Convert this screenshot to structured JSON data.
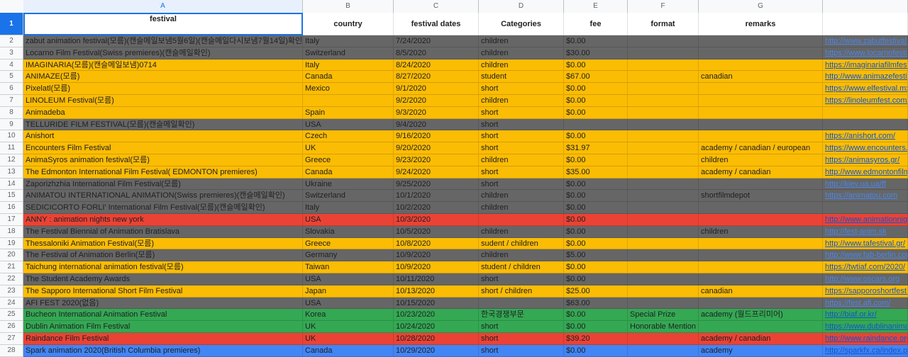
{
  "columns": [
    {
      "letter": "A",
      "header": "festival"
    },
    {
      "letter": "B",
      "header": "country"
    },
    {
      "letter": "C",
      "header": "festival dates"
    },
    {
      "letter": "D",
      "header": "Categories"
    },
    {
      "letter": "E",
      "header": "fee"
    },
    {
      "letter": "F",
      "header": "format"
    },
    {
      "letter": "G",
      "header": "remarks"
    },
    {
      "letter": "",
      "header": ""
    }
  ],
  "header_row_number": "1",
  "colors": {
    "gray": "#666666",
    "orange": "#fbbc04",
    "red": "#ea4335",
    "green": "#34a853",
    "blue": "#4285f4",
    "selection": "#1a73e8"
  },
  "rows": [
    {
      "n": "2",
      "color": "gray",
      "cells": [
        "zabut animation festival(모름)(캔슬메일보냄5월6일)(캔슬메일다시보냄7월14일)확인",
        "Italy",
        "7/24/2020",
        "children",
        "$0.00",
        "",
        "",
        "http://www.zabutfestival.it"
      ]
    },
    {
      "n": "3",
      "color": "gray",
      "cells": [
        "Locarno Film Festival(Swiss premieres)(캔슬메일확인)",
        "Switzerland",
        "8/5/2020",
        "children",
        "$30.00",
        "",
        "",
        "https://www.locarnofestival.ch"
      ]
    },
    {
      "n": "4",
      "color": "orange",
      "cells": [
        "IMAGINARIA(모름)(캔슬메일보냄)0714",
        "Italy",
        "8/24/2020",
        "children",
        "$0.00",
        "",
        "",
        "https://imaginariafilmfestival.org"
      ]
    },
    {
      "n": "5",
      "color": "orange",
      "cells": [
        "ANIMAZE(모름)",
        "Canada",
        "8/27/2020",
        "student",
        "$67.00",
        "",
        " canadian",
        "http://www.animazefestival.com"
      ]
    },
    {
      "n": "6",
      "color": "orange",
      "cells": [
        "Pixelatl(모름)",
        "Mexico",
        "9/1/2020",
        "short",
        "$0.00",
        "",
        "",
        "https://www.elfestival.mx/"
      ]
    },
    {
      "n": "7",
      "color": "orange",
      "cells": [
        "LINOLEUM Festival(모름)",
        "",
        "9/2/2020",
        "children",
        "$0.00",
        "",
        "",
        "https://linoleumfest.com/en"
      ]
    },
    {
      "n": "8",
      "color": "orange",
      "cells": [
        "Animadeba",
        "Spain",
        "9/3/2020",
        "short",
        "$0.00",
        "",
        "",
        ""
      ]
    },
    {
      "n": "9",
      "color": "gray",
      "cells": [
        "TELLURIDE FILM FESTIVAL(모름)(캔슬메일확인)",
        "USA",
        "9/4/2020",
        "short",
        "",
        "",
        "",
        ""
      ]
    },
    {
      "n": "10",
      "color": "orange",
      "cells": [
        "Anishort",
        "Czech",
        "9/16/2020",
        "short",
        "$0.00",
        "",
        "",
        "https://anishort.com/"
      ]
    },
    {
      "n": "11",
      "color": "orange",
      "cells": [
        "Encounters Film Festival",
        "UK",
        "9/20/2020",
        "short",
        "$31.97",
        "",
        "academy / canadian / european",
        "https://www.encounters.film"
      ]
    },
    {
      "n": "12",
      "color": "orange",
      "cells": [
        "AnimaSyros animation festival(모름)",
        "Greece",
        "9/23/2020",
        "children",
        "$0.00",
        "",
        "children",
        "https://animasyros.gr/"
      ]
    },
    {
      "n": "13",
      "color": "orange",
      "cells": [
        "The Edmonton International Film Festival( EDMONTON premieres)",
        "Canada",
        "9/24/2020",
        "short",
        "$35.00",
        "",
        "academy / canadian",
        "http://www.edmontonfilmfest.com"
      ]
    },
    {
      "n": "14",
      "color": "gray",
      "cells": [
        "Zaporizhzhia International Film Festival(모름)",
        "Ukraine",
        "9/25/2020",
        "short",
        "$0.00",
        "",
        "",
        "http://kiev.ua.ua/ff"
      ]
    },
    {
      "n": "15",
      "color": "gray",
      "cells": [
        "ANIMATOU INTERNATIONAL ANIMATION(Swiss premieres)(캔슬메일확인)",
        "Switzerland",
        "10/1/2020",
        "children",
        "$0.00",
        "",
        "shortfilmdepot",
        "https://animatou.com"
      ]
    },
    {
      "n": "16",
      "color": "gray",
      "cells": [
        "SEDICICORTO FORLI' International Film Festival(모름)(캔슬메일확인)",
        "Italy",
        "10/2/2020",
        "children",
        "$0.00",
        "",
        "",
        ""
      ]
    },
    {
      "n": "17",
      "color": "red",
      "cells": [
        "ANNY : animation nights new york",
        "USA",
        "10/3/2020",
        "",
        "$0.00",
        "",
        "",
        "http://www.animationnights.com"
      ]
    },
    {
      "n": "18",
      "color": "gray",
      "cells": [
        "The Festival Biennial of Animation Bratislava",
        "Slovakia",
        "10/5/2020",
        "children",
        "$0.00",
        "",
        "children",
        "http://fest-anim.sk"
      ]
    },
    {
      "n": "19",
      "color": "orange",
      "cells": [
        "Thessaloniki Animation Festival(모름)",
        "Greece",
        "10/8/2020",
        "sudent / children",
        "$0.00",
        "",
        "",
        "http://www.tafestival.gr/"
      ]
    },
    {
      "n": "20",
      "color": "gray",
      "cells": [
        "The Festival of Animation Berlin(모름)",
        "Germany",
        "10/9/2020",
        "children",
        "$5.00",
        "",
        "",
        "http://www.fab-berlin.com"
      ]
    },
    {
      "n": "21",
      "color": "orange",
      "cells": [
        "Taichung international animation festival(모름)",
        "Taiwan",
        "10/9/2020",
        "student / children",
        "$0.00",
        "",
        "",
        "https://twtiaf.com/2020/"
      ]
    },
    {
      "n": "22",
      "color": "gray",
      "cells": [
        "The Student Academy Awards",
        "USA",
        "10/11/2020",
        "short",
        "$0.00",
        "",
        "",
        "http://www.oscars.org"
      ]
    },
    {
      "n": "23",
      "color": "orange",
      "cells": [
        "The Sapporo International Short Film Festival",
        "Japan",
        "10/13/2020",
        "short / children",
        "$25.00",
        "",
        "canadian",
        "https://sapporoshortfest.jp"
      ]
    },
    {
      "n": "24",
      "color": "gray",
      "cells": [
        "AFI FEST 2020(없음)",
        "USA",
        "10/15/2020",
        "",
        "$63.00",
        "",
        "",
        "https://fest.afi.com/"
      ]
    },
    {
      "n": "25",
      "color": "green",
      "cells": [
        "Bucheon International Animation Festival",
        "Korea",
        "10/23/2020",
        "한국경쟁부문",
        "$0.00",
        "Special Prize",
        "academy (월드프리미어)",
        "http://biaf.or.kr/"
      ]
    },
    {
      "n": "26",
      "color": "green",
      "cells": [
        "Dublin Animation Film Festival",
        "UK",
        "10/24/2020",
        "short",
        "$0.00",
        "Honorable Mention",
        "",
        "https://www.dublinanimationfest"
      ]
    },
    {
      "n": "27",
      "color": "red",
      "cells": [
        "Raindance Film Festival",
        "UK",
        "10/28/2020",
        "short",
        "$39.20",
        "",
        "academy / canadian",
        "http://www.raindance.org"
      ]
    },
    {
      "n": "28",
      "color": "blue",
      "cells": [
        "Spark animation 2020(British Columbia premieres)",
        "Canada",
        "10/29/2020",
        "short",
        "$0.00",
        "",
        "academy",
        "http://sparkfx.ca/index.php"
      ]
    }
  ]
}
